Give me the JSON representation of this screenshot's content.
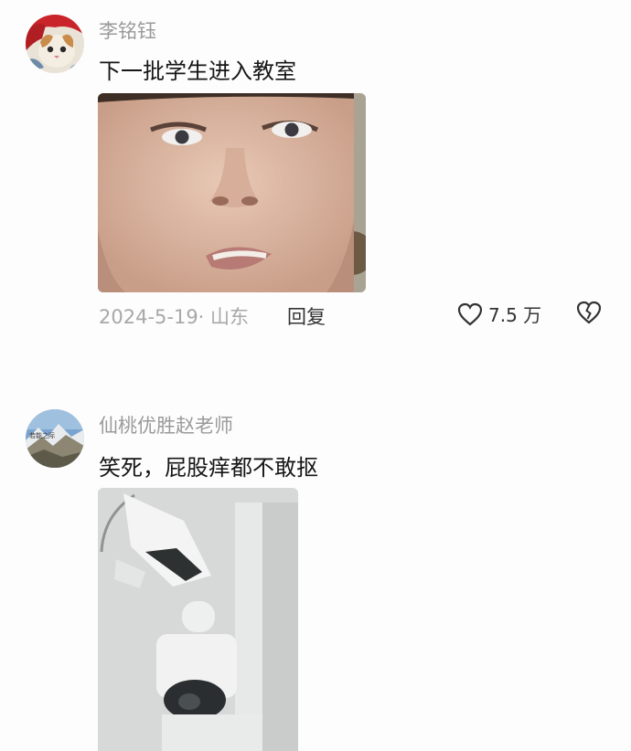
{
  "comments": [
    {
      "username": "李铭钰",
      "text": "下一批学生进入教室",
      "date_location": "2024-5-19· 山东",
      "reply_label": "回复",
      "like_count": "7.5 万",
      "avatar_icon": "cat-avatar",
      "image_icon": "face-photo"
    },
    {
      "username": "仙桃优胜赵老师",
      "text": "笑死，屁股痒都不敢抠",
      "avatar_icon": "landscape-avatar",
      "image_icon": "security-camera-photo"
    }
  ],
  "icons": {
    "like": "heart-outline-icon",
    "dislike": "broken-heart-icon"
  }
}
